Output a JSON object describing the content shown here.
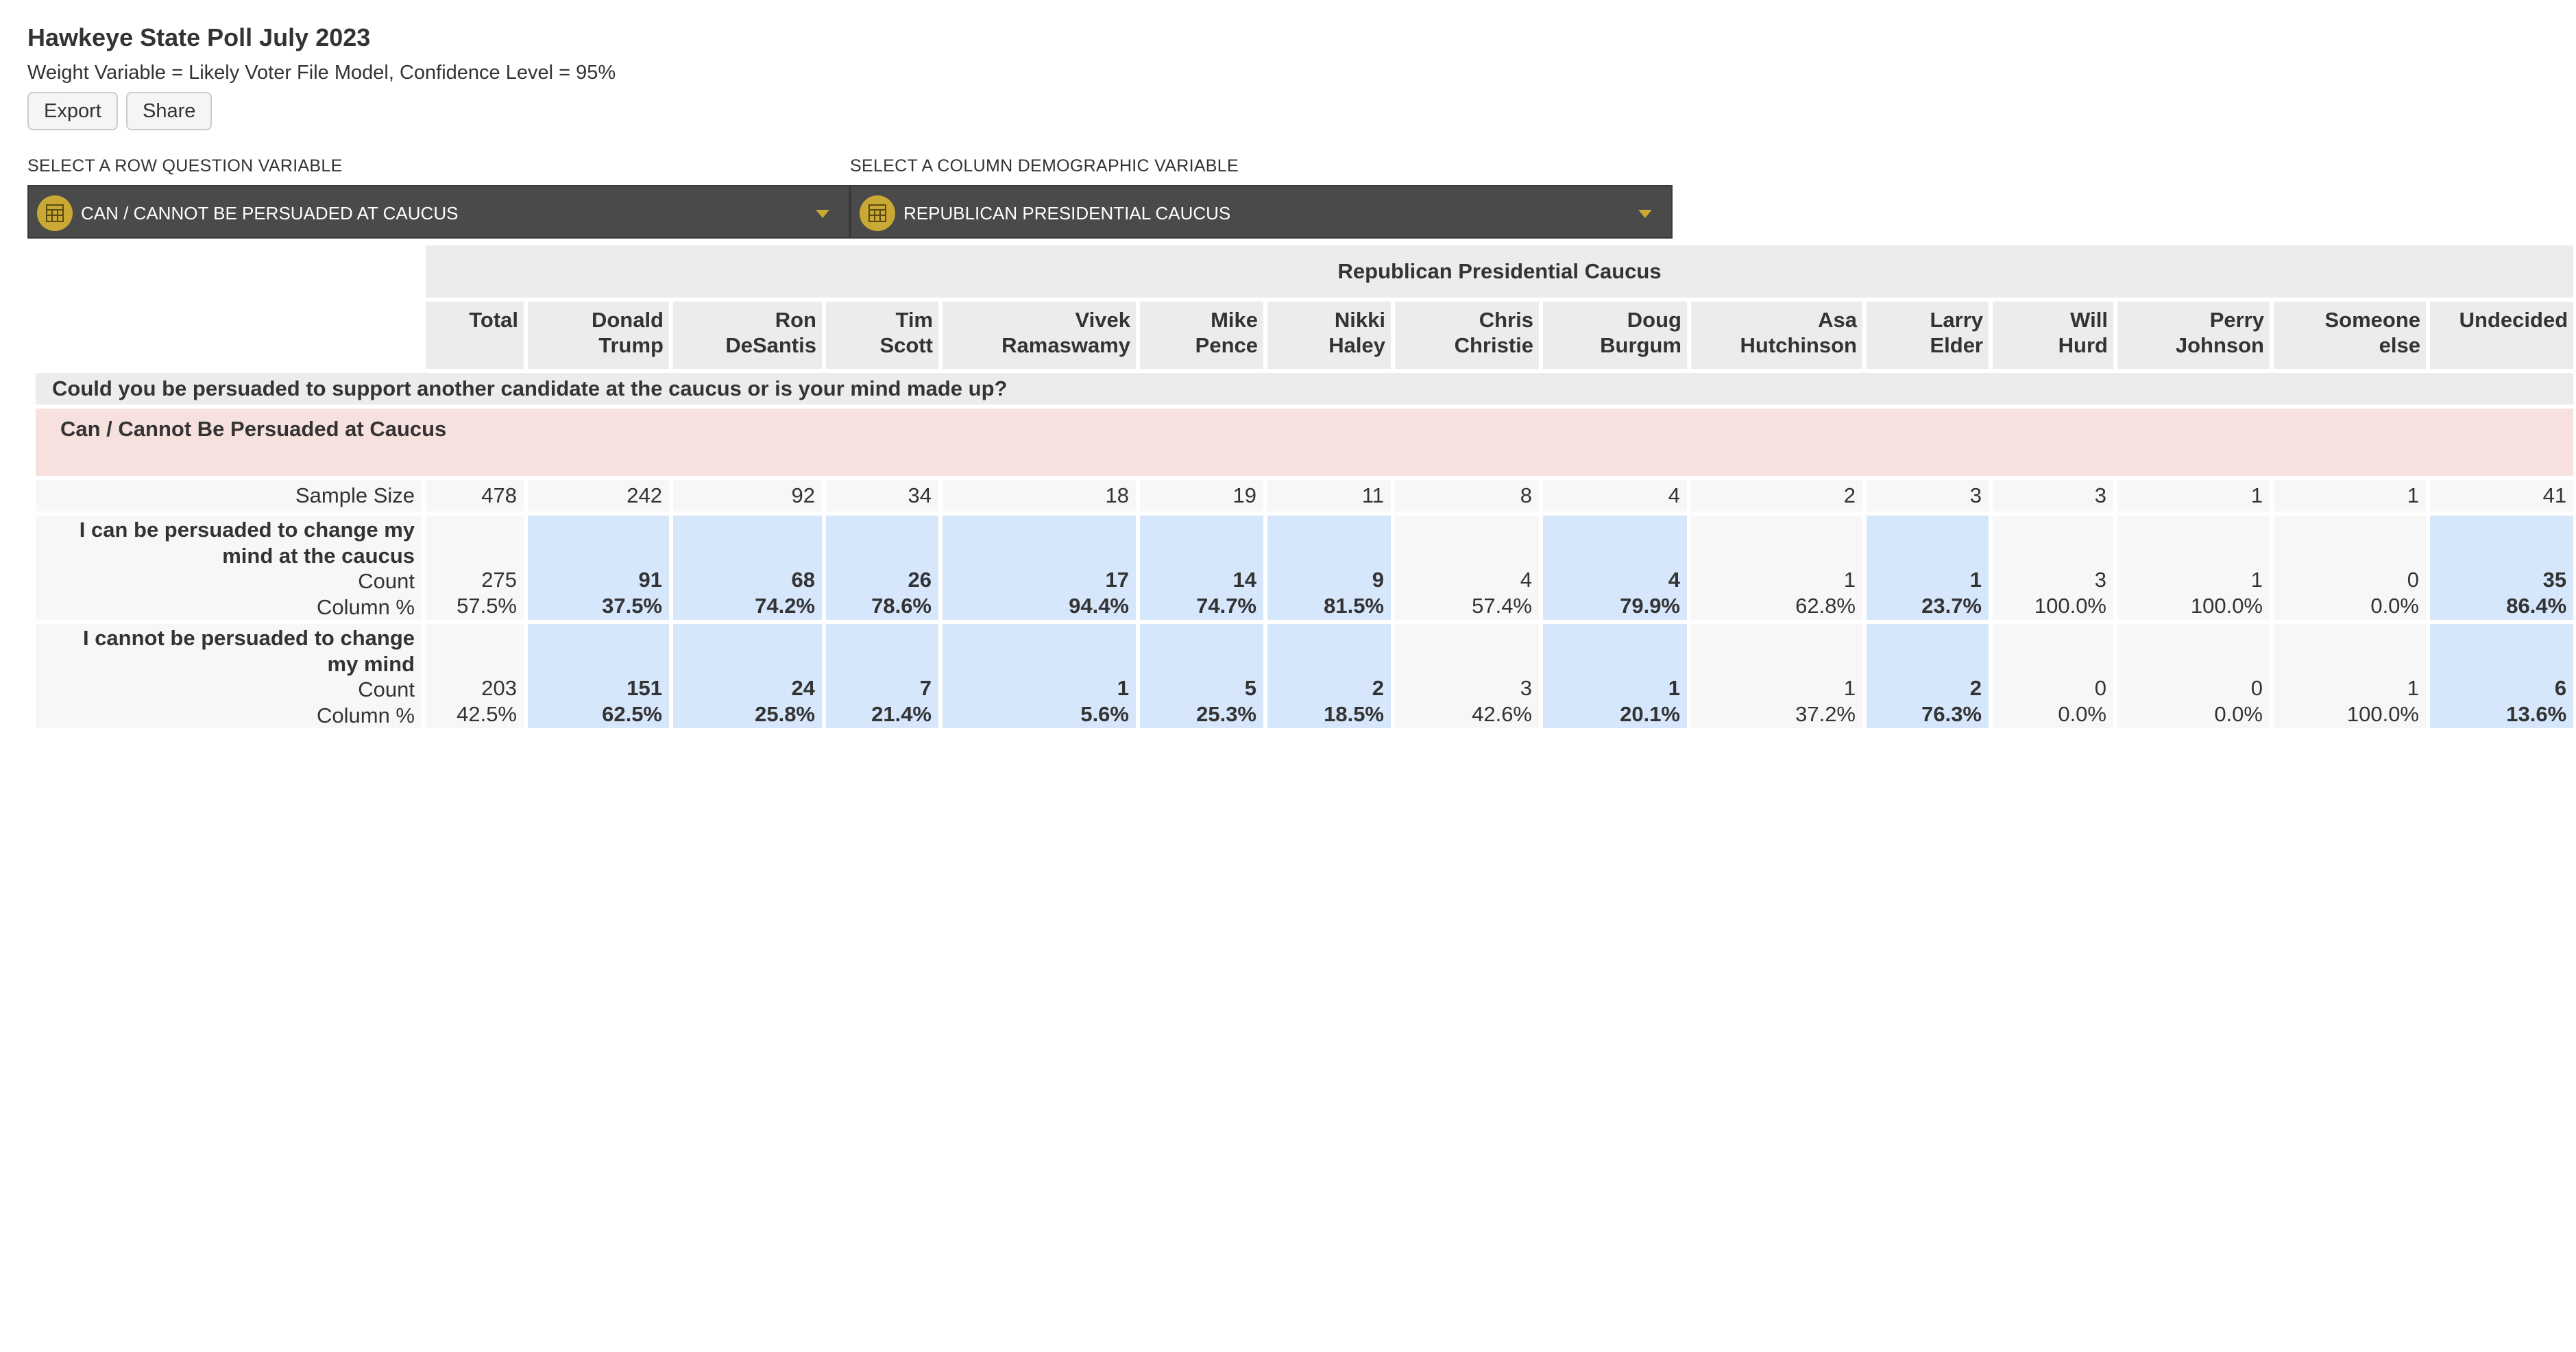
{
  "header": {
    "title": "Hawkeye State Poll July 2023",
    "subtitle": "Weight Variable = Likely Voter File Model, Confidence Level = 95%",
    "export_label": "Export",
    "share_label": "Share"
  },
  "selectors": {
    "row_label": "SELECT A ROW QUESTION VARIABLE",
    "row_value": "CAN / CANNOT BE PERSUADED AT CAUCUS",
    "col_label": "SELECT A COLUMN DEMOGRAPHIC VARIABLE",
    "col_value": "REPUBLICAN PRESIDENTIAL CAUCUS"
  },
  "table": {
    "banner": "Republican Presidential Caucus",
    "columns": [
      {
        "l1": "Total",
        "l2": ""
      },
      {
        "l1": "Donald",
        "l2": "Trump"
      },
      {
        "l1": "Ron",
        "l2": "DeSantis"
      },
      {
        "l1": "Tim",
        "l2": "Scott"
      },
      {
        "l1": "Vivek",
        "l2": "Ramaswamy"
      },
      {
        "l1": "Mike",
        "l2": "Pence"
      },
      {
        "l1": "Nikki",
        "l2": "Haley"
      },
      {
        "l1": "Chris",
        "l2": "Christie"
      },
      {
        "l1": "Doug",
        "l2": "Burgum"
      },
      {
        "l1": "Asa",
        "l2": "Hutchinson"
      },
      {
        "l1": "Larry",
        "l2": "Elder"
      },
      {
        "l1": "Will",
        "l2": "Hurd"
      },
      {
        "l1": "Perry",
        "l2": "Johnson"
      },
      {
        "l1": "Someone",
        "l2": "else"
      },
      {
        "l1": "Undecided",
        "l2": ""
      }
    ],
    "question": "Could you be persuaded to support another candidate at the caucus or is your mind made up?",
    "group_label": "Can / Cannot Be Persuaded at Caucus",
    "sample_label": "Sample Size",
    "sample": [
      "478",
      "242",
      "92",
      "34",
      "18",
      "19",
      "11",
      "8",
      "4",
      "2",
      "3",
      "3",
      "1",
      "1",
      "41"
    ],
    "count_label": "Count",
    "pct_label": "Column %",
    "rows": [
      {
        "label_l1": "I can be persuaded to change my",
        "label_l2": "mind at the caucus",
        "counts": [
          "275",
          "91",
          "68",
          "26",
          "17",
          "14",
          "9",
          "4",
          "4",
          "1",
          "1",
          "3",
          "1",
          "0",
          "35"
        ],
        "pcts": [
          "57.5%",
          "37.5%",
          "74.2%",
          "78.6%",
          "94.4%",
          "74.7%",
          "81.5%",
          "57.4%",
          "79.9%",
          "62.8%",
          "23.7%",
          "100.0%",
          "100.0%",
          "0.0%",
          "86.4%"
        ]
      },
      {
        "label_l1": "I cannot be persuaded to change",
        "label_l2": "my mind",
        "counts": [
          "203",
          "151",
          "24",
          "7",
          "1",
          "5",
          "2",
          "3",
          "1",
          "1",
          "2",
          "0",
          "0",
          "1",
          "6"
        ],
        "pcts": [
          "42.5%",
          "62.5%",
          "25.8%",
          "21.4%",
          "5.6%",
          "25.3%",
          "18.5%",
          "42.6%",
          "20.1%",
          "37.2%",
          "76.3%",
          "0.0%",
          "0.0%",
          "100.0%",
          "13.6%"
        ]
      }
    ]
  },
  "colors": {
    "highlight": "#d6e6fb",
    "group_band": "#f7e1df",
    "header_gray": "#ececec",
    "selector_bg": "#4a4a4a",
    "selector_accent": "#c9a934"
  }
}
